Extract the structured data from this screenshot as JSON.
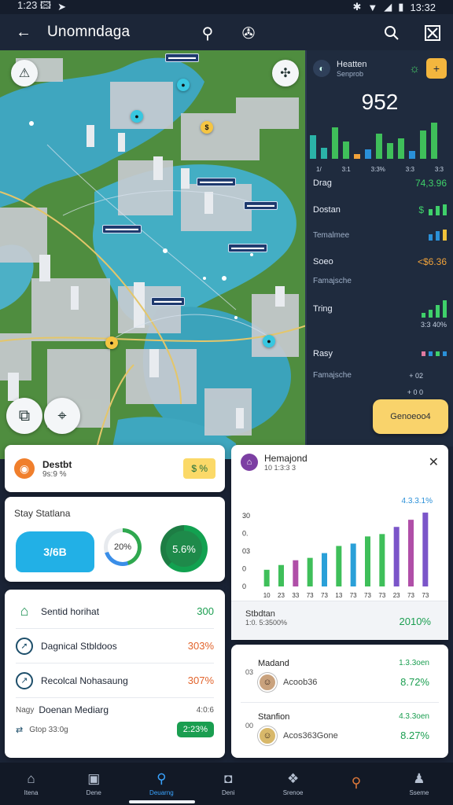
{
  "status_bar": {
    "time": "1:23 🖾",
    "battery": "13:32"
  },
  "app_bar": {
    "title": "Unomndaga",
    "icons": [
      "back-arrow-icon",
      "pin-icon",
      "bug-icon",
      "search-icon",
      "close-icon"
    ]
  },
  "map": {
    "labels": [
      "▬▬▬▬▬",
      "▬▬▬▬▬▬",
      "▬▬▬▬▬",
      "▬▬▬▬▬▬",
      "▬▬▬▬▬",
      "▬▬▬▬▬▬"
    ],
    "fab_icons": [
      "triangle-tool-icon",
      "compass-icon",
      "layers-icon",
      "crop-icon"
    ]
  },
  "right_panel": {
    "name": "Heatten",
    "subtitle": "Senprob",
    "big_number": "952",
    "ticks": [
      "1/",
      "3:1",
      "3:3%",
      "3:3",
      "3:3"
    ],
    "rows": [
      {
        "label": "Drag",
        "value": "74,3.96",
        "color": "#3fd06a"
      },
      {
        "label": "Dostan",
        "value": "$",
        "color": "#3fd06a"
      },
      {
        "label": "Temalmee",
        "value": "",
        "color": "#8fb0ff"
      },
      {
        "label": "Soeo",
        "value": "<$6.36",
        "color": "#f0a23a"
      },
      {
        "label": "Famajsche",
        "value": "",
        "color": "#9fb0c8"
      },
      {
        "label": "Tring",
        "value": "3:3 40%",
        "color": "#3fd06a"
      },
      {
        "label": "Rasy",
        "value": "",
        "color": "#e07aa0"
      },
      {
        "label": "Famajsche",
        "value": "+ 02",
        "color": "#9fb0c8"
      },
      {
        "label": "",
        "value": "+ 0 0",
        "color": "#9fb0c8"
      }
    ],
    "cta": "Genoeoo4"
  },
  "card_status": {
    "title": "Destbt",
    "subtitle": "9s:9   %",
    "tag": "$ %"
  },
  "card_stats": {
    "title": "Stay Statlana",
    "blob_value": "3/6B",
    "ring1": "20%",
    "ring2": "5.6%"
  },
  "card_list": {
    "rows": [
      {
        "icon": "home-icon",
        "label": "Sentid horihat",
        "value": "300",
        "color": "green"
      },
      {
        "icon": "compass-icon",
        "label": "Dagnical Stbldoos",
        "value": "303%",
        "color": "orange"
      },
      {
        "icon": "route-icon",
        "label": "Recolcal Nohasaung",
        "value": "307%",
        "color": "orange"
      }
    ],
    "last": {
      "label_prefix": "Nagy",
      "label": "Doenan Mediarg",
      "sub": "Gtop 33:0g",
      "top_value": "4:0:6",
      "badge": "2:23%"
    }
  },
  "card_chart": {
    "title": "Hemajond",
    "subtitle": "10  1:3:3   3",
    "footer_title": "Stbdtan",
    "footer_sub": "1:0. 5:3500%",
    "footer_value": "2010%",
    "chart_data": {
      "type": "bar",
      "categories": [
        "10",
        "23",
        "33",
        "73",
        "73",
        "13",
        "73",
        "73",
        "73",
        "23",
        "73",
        "73"
      ],
      "values": [
        7,
        9,
        11,
        12,
        14,
        17,
        18,
        21,
        22,
        25,
        28,
        31
      ],
      "colors": [
        "#3fbf5a",
        "#3fbf5a",
        "#b04fa8",
        "#3fbf5a",
        "#2aa0d8",
        "#3fbf5a",
        "#2aa0d8",
        "#3fbf5a",
        "#3fbf5a",
        "#7b55c9",
        "#b04fa8",
        "#7b55c9"
      ],
      "y_ticks": [
        "30",
        "0.",
        "03",
        "0",
        "0"
      ],
      "top_label": "4.3.3.1%"
    }
  },
  "card_people": {
    "rows": [
      {
        "name": "Madand",
        "prefix": "03",
        "sub": "Acoob36",
        "top": "1.3.3oen",
        "value": "8.72%"
      },
      {
        "name": "Stanfion",
        "prefix": "00",
        "sub": "Acos363Gone",
        "top": "4.3.3oen",
        "value": "8.27%"
      }
    ]
  },
  "bottom_nav": {
    "items": [
      {
        "icon": "home-icon",
        "label": "Itena"
      },
      {
        "icon": "image-icon",
        "label": "Dene"
      },
      {
        "icon": "search-icon",
        "label": "Deuarng"
      },
      {
        "icon": "tile-icon",
        "label": "Deni"
      },
      {
        "icon": "layers-icon",
        "label": "Srenoe"
      },
      {
        "icon": "magnify-icon",
        "label": ""
      },
      {
        "icon": "person-icon",
        "label": "Sseme"
      }
    ],
    "active_index": 2
  }
}
